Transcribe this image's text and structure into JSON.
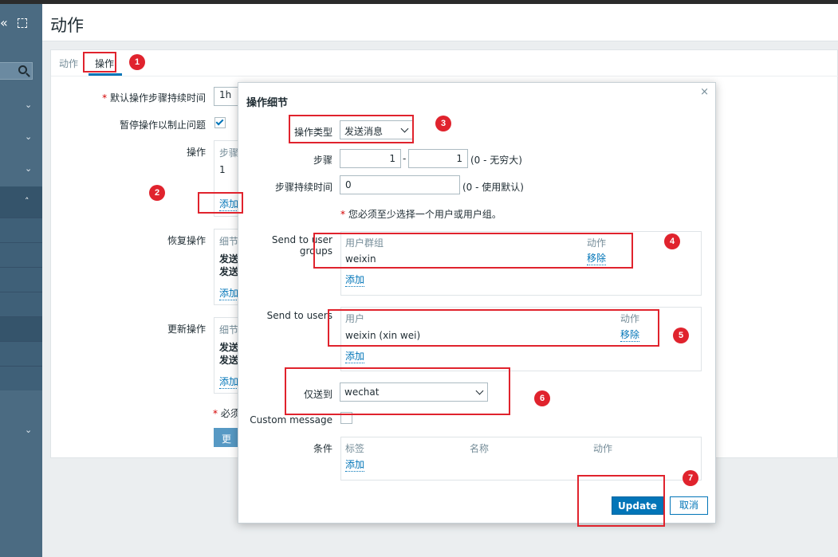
{
  "header": {
    "title": "动作"
  },
  "tabs": [
    {
      "label": "动作"
    },
    {
      "label": "操作"
    }
  ],
  "background_form": {
    "default_step_duration_label": "默认操作步骤持续时间",
    "default_step_duration_value": "1h",
    "pause_label": "暂停操作以制止问题",
    "pause_checked": true,
    "operations_label": "操作",
    "operations_col": "步骤",
    "operations_row_value": "1",
    "operations_add": "添加",
    "recovery_label": "恢复操作",
    "recovery_col": "细节",
    "recovery_line1": "发送",
    "recovery_line2": "发送",
    "recovery_add": "添加",
    "update_ops_label": "更新操作",
    "update_col": "细节",
    "update_line1": "发送",
    "update_line2": "发送",
    "update_add": "添加",
    "required_note": "必须",
    "update_button": "更新"
  },
  "dialog": {
    "title": "操作细节",
    "close": "×",
    "op_type_label": "操作类型",
    "op_type_value": "发送消息",
    "steps_label": "步骤",
    "step_from": "1",
    "step_sep": "-",
    "step_to": "1",
    "step_hint": "(0 - 无穷大)",
    "step_duration_label": "步骤持续时间",
    "step_duration_value": "0",
    "step_duration_hint": "(0 - 使用默认)",
    "required_warning": "您必须至少选择一个用户或用户组。",
    "send_groups_label": "Send to user groups",
    "groups_col_name": "用户群组",
    "groups_col_action": "动作",
    "groups_rows": [
      {
        "name": "weixin",
        "action": "移除"
      }
    ],
    "groups_add": "添加",
    "send_users_label": "Send to users",
    "users_col_name": "用户",
    "users_col_action": "动作",
    "users_rows": [
      {
        "name": "weixin (xin wei)",
        "action": "移除"
      }
    ],
    "users_add": "添加",
    "send_only_to_label": "仅送到",
    "send_only_to_value": "wechat",
    "custom_message_label": "Custom message",
    "custom_message_checked": false,
    "conditions_label": "条件",
    "cond_col_label": "标签",
    "cond_col_name": "名称",
    "cond_col_action": "动作",
    "cond_add": "添加",
    "update_button": "Update",
    "cancel_button": "取消"
  },
  "annotations": {
    "badges": [
      "1",
      "2",
      "3",
      "4",
      "5",
      "6",
      "7"
    ],
    "color": "#e0232d"
  },
  "colors": {
    "sidebar": "#4b6b82",
    "accent": "#0275b8",
    "annotation": "#e0232d"
  }
}
